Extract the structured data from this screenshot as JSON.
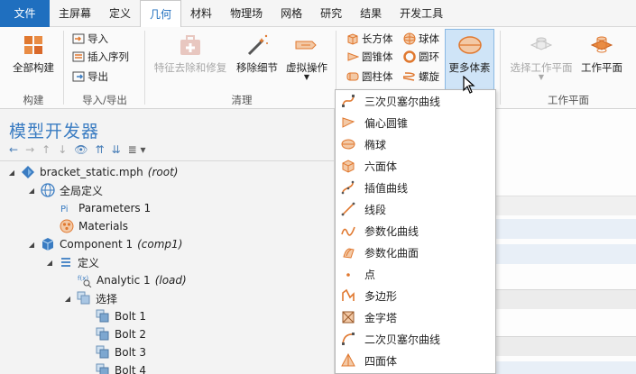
{
  "menubar": {
    "file": "文件",
    "items": [
      "主屏幕",
      "定义",
      "几何",
      "材料",
      "物理场",
      "网格",
      "研究",
      "结果",
      "开发工具"
    ],
    "active_index": 2
  },
  "ribbon": {
    "build_all": "全部构建",
    "group_build": "构建",
    "import": "导入",
    "insert_sequence": "插入序列",
    "export": "导出",
    "group_import_export": "导入/导出",
    "remove_details": "特征去除和修复",
    "remove_fillets": "移除细节",
    "virtual_ops": "虚拟操作",
    "group_cleanup": "清理",
    "block": "长方体",
    "sphere": "球体",
    "cone": "圆锥体",
    "torus": "圆环",
    "cylinder": "圆柱体",
    "helix": "螺旋",
    "more_primitives": "更多体素",
    "select_work_plane": "选择工作平面",
    "work_plane": "工作平面",
    "group_work_plane": "工作平面"
  },
  "model_builder": {
    "title": "模型开发器",
    "tree": [
      {
        "label": "bracket_static.mph",
        "tag": "(root)"
      },
      {
        "label": "全局定义",
        "tag": ""
      },
      {
        "label": "Parameters 1",
        "tag": ""
      },
      {
        "label": "Materials",
        "tag": ""
      },
      {
        "label": "Component 1",
        "tag": "(comp1)"
      },
      {
        "label": "定义",
        "tag": ""
      },
      {
        "label": "Analytic 1",
        "tag": "(load)"
      },
      {
        "label": "选择",
        "tag": ""
      },
      {
        "label": "Bolt 1",
        "tag": ""
      },
      {
        "label": "Bolt 2",
        "tag": ""
      },
      {
        "label": "Bolt 3",
        "tag": ""
      },
      {
        "label": "Bolt 4",
        "tag": ""
      }
    ]
  },
  "dropdown": {
    "items": [
      "三次贝塞尔曲线",
      "偏心圆锥",
      "椭球",
      "六面体",
      "插值曲线",
      "线段",
      "参数化曲线",
      "参数化曲面",
      "点",
      "多边形",
      "金字塔",
      "二次贝塞尔曲线",
      "四面体"
    ]
  },
  "colors": {
    "accent": "#1f6fbf",
    "title_blue": "#3a7cc2",
    "icon_orange": "#e0782f",
    "highlight": "#cfe4f7"
  }
}
